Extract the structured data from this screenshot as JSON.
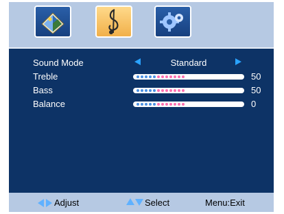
{
  "tabs": [
    {
      "icon": "picture-icon",
      "selected": false
    },
    {
      "icon": "music-note-icon",
      "selected": true
    },
    {
      "icon": "gear-icon",
      "selected": false
    }
  ],
  "sound": {
    "mode_label": "Sound Mode",
    "mode_value": "Standard",
    "rows": [
      {
        "label": "Treble",
        "value": "50",
        "level": 0.5
      },
      {
        "label": "Bass",
        "value": "50",
        "level": 0.5
      },
      {
        "label": "Balance",
        "value": "0",
        "level": 0.5
      }
    ]
  },
  "footer": {
    "adjust": "Adjust",
    "select": "Select",
    "menu_exit": "Menu:Exit"
  },
  "colors": {
    "panel": "#0d3366",
    "bar": "#b6c9e3",
    "arrow": "#2aa3ff",
    "dot_blue": "#4a90e2",
    "dot_pink": "#ff6fb0"
  }
}
